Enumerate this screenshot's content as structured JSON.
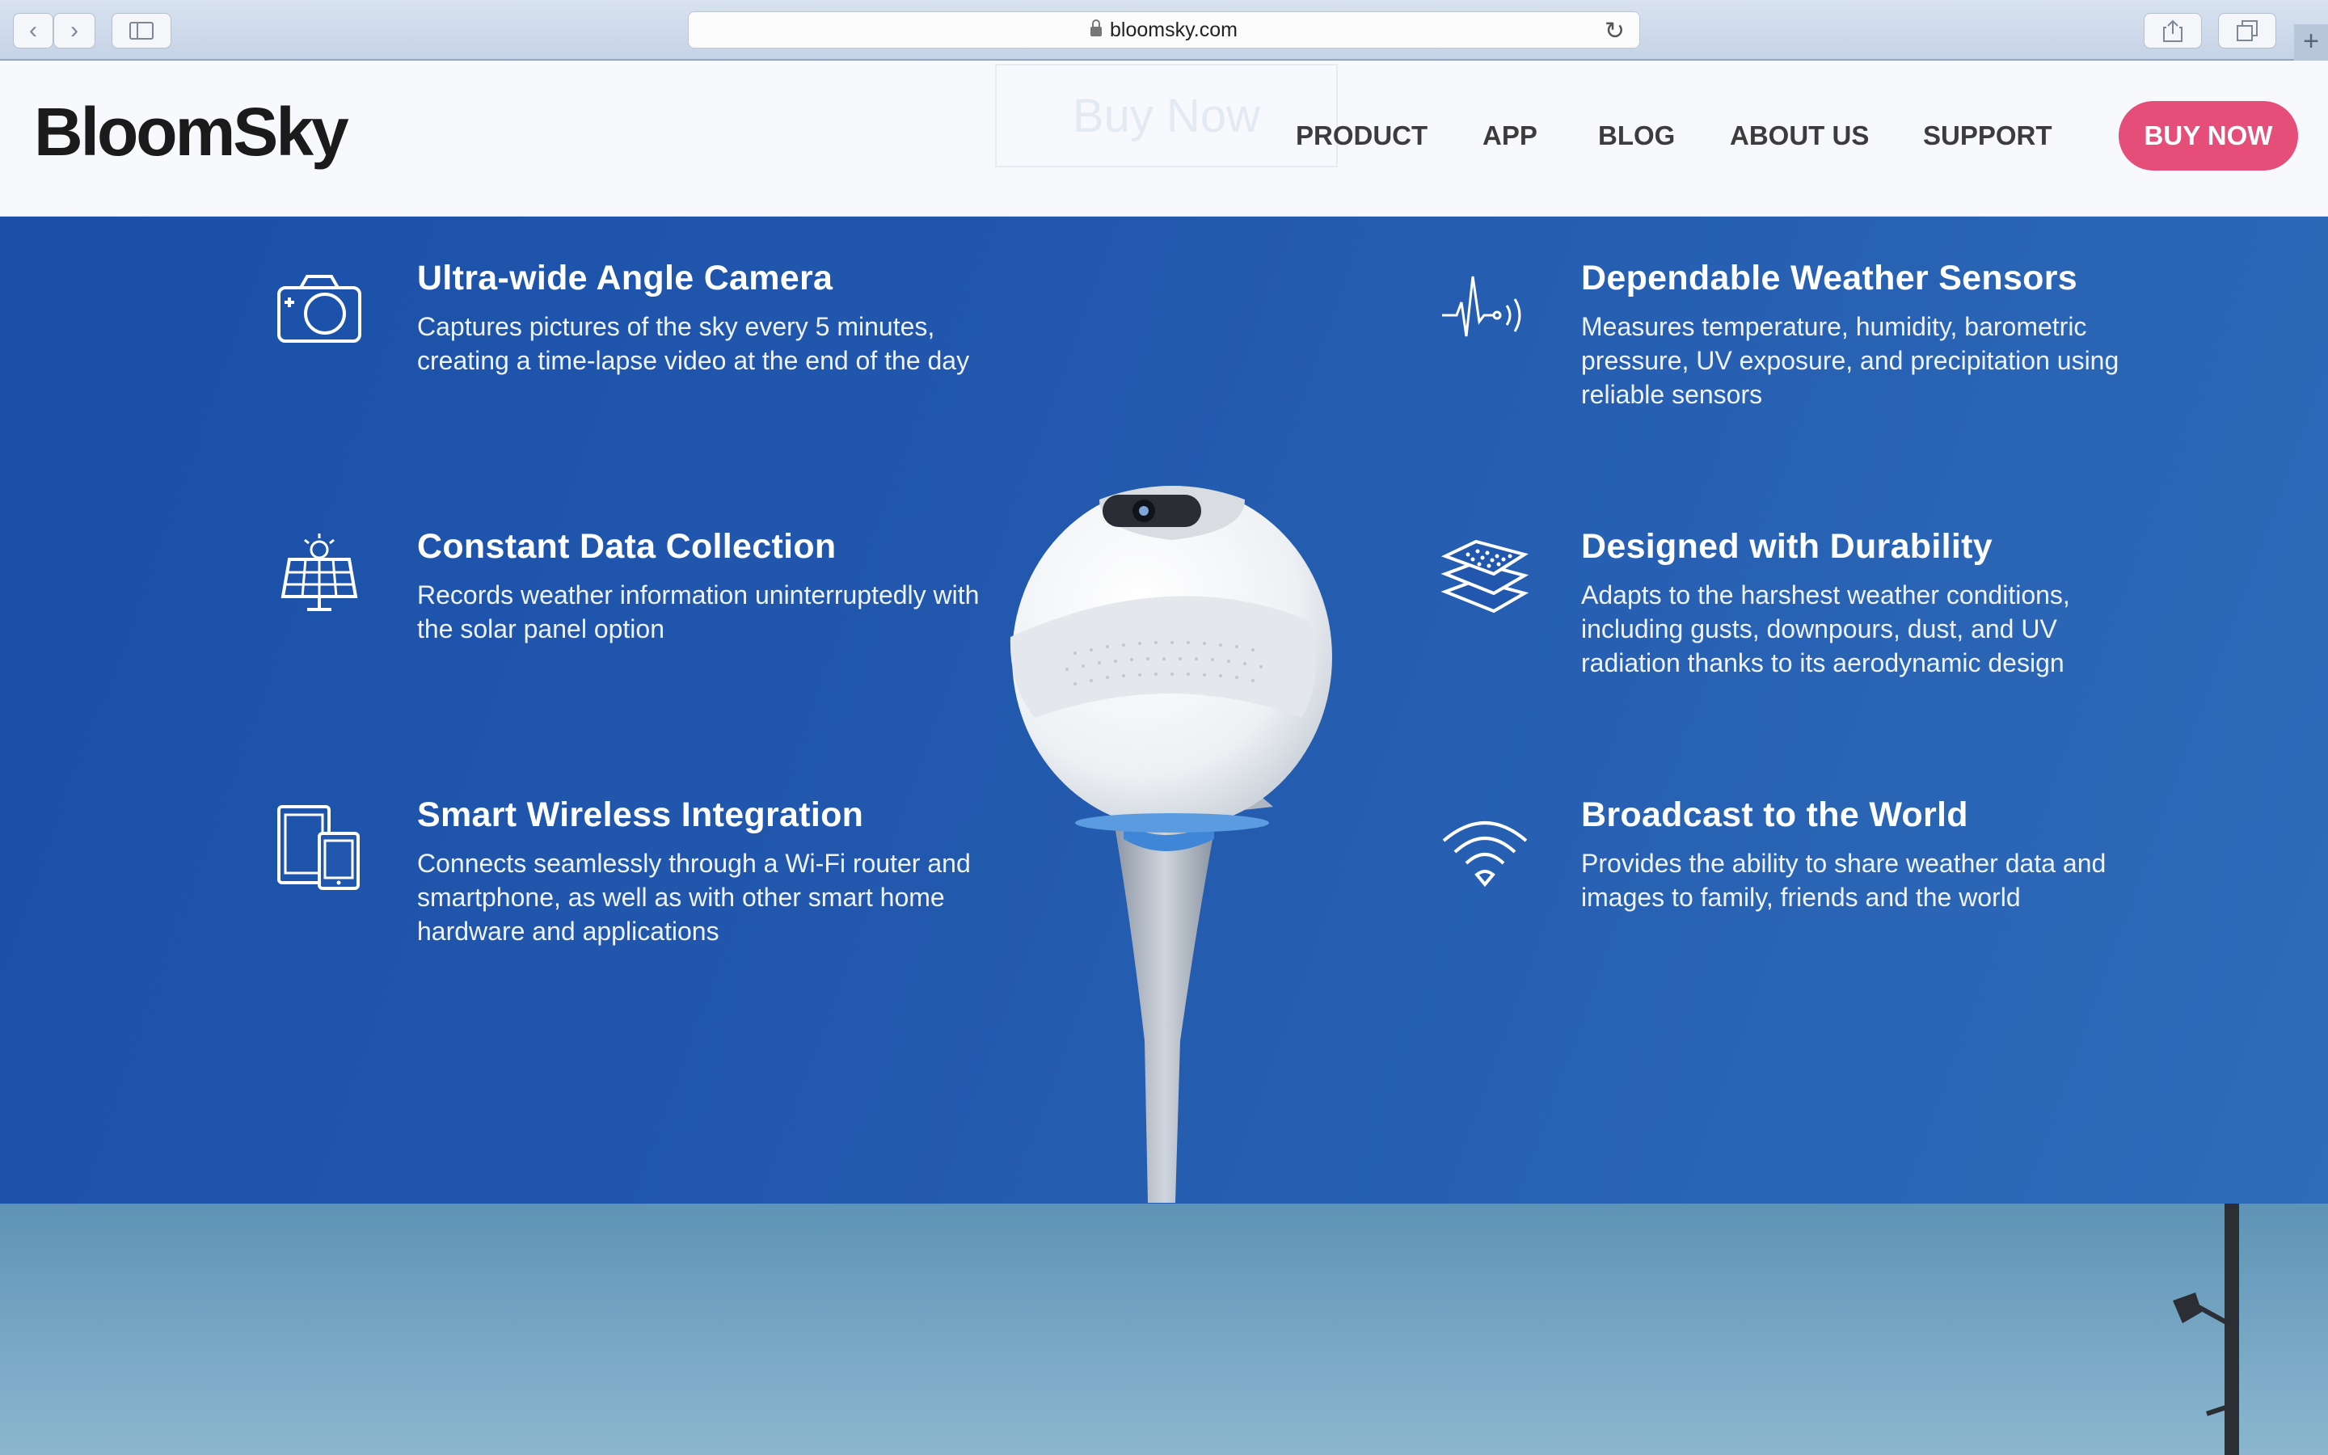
{
  "browser": {
    "url": "bloomsky.com",
    "back_icon": "chevron-left-icon",
    "forward_icon": "chevron-right-icon"
  },
  "header": {
    "logo": "BloomSky",
    "ghost_button": "Buy Now",
    "menu": [
      "PRODUCT",
      "APP",
      "BLOG",
      "ABOUT US",
      "SUPPORT"
    ],
    "buy_button": "BUY NOW",
    "accent_color": "#e64e7a"
  },
  "features": [
    {
      "icon": "camera-icon",
      "title": "Ultra-wide Angle Camera",
      "desc": "Captures pictures of the sky every 5 minutes, creating a time-lapse video at the end of the day"
    },
    {
      "icon": "solar-panel-icon",
      "title": "Constant Data Collection",
      "desc": "Records weather information uninterruptedly with the solar panel option"
    },
    {
      "icon": "devices-icon",
      "title": "Smart Wireless Integration",
      "desc": "Connects seamlessly through a Wi-Fi router and smartphone, as well as with other smart home hardware and applications"
    },
    {
      "icon": "sensor-pulse-icon",
      "title": "Dependable Weather Sensors",
      "desc": "Measures temperature, humidity, barometric pressure, UV exposure, and precipitation using reliable sensors"
    },
    {
      "icon": "layers-icon",
      "title": "Designed with Durability",
      "desc": "Adapts to the harshest weather conditions, including gusts, downpours, dust, and UV radiation thanks to its aerodynamic design"
    },
    {
      "icon": "wifi-icon",
      "title": "Broadcast to the World",
      "desc": "Provides the ability to share weather data and images to family, friends and the world"
    }
  ]
}
